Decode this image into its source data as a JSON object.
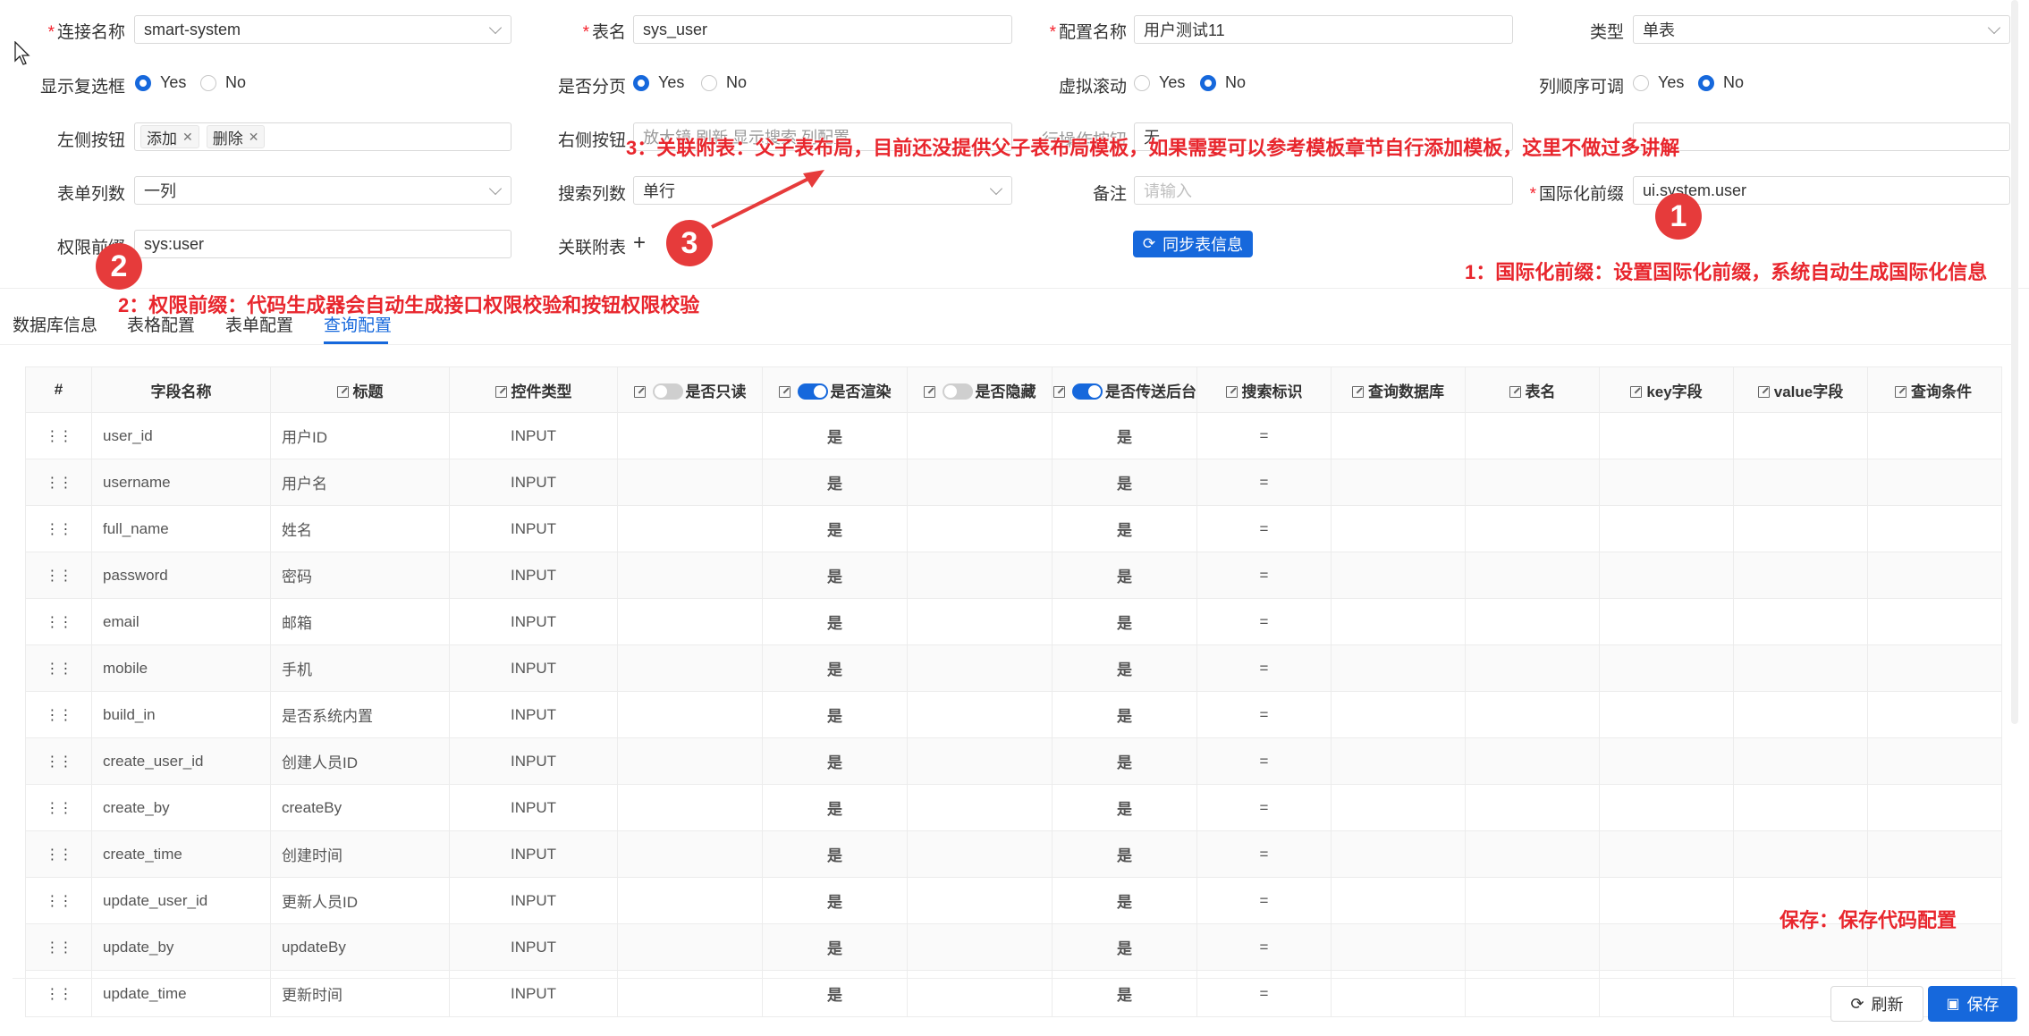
{
  "form": {
    "conn": {
      "label": "连接名称",
      "value": "smart-system"
    },
    "table": {
      "label": "表名",
      "value": "sys_user"
    },
    "config": {
      "label": "配置名称",
      "value": "用户测试11"
    },
    "type": {
      "label": "类型",
      "value": "单表"
    },
    "show_checkbox": {
      "label": "显示复选框",
      "yes": "Yes",
      "no": "No",
      "selected": "Yes"
    },
    "paging": {
      "label": "是否分页",
      "yes": "Yes",
      "no": "No",
      "selected": "Yes"
    },
    "virtual_scroll": {
      "label": "虚拟滚动",
      "yes": "Yes",
      "no": "No",
      "selected": "No"
    },
    "col_order": {
      "label": "列顺序可调",
      "yes": "Yes",
      "no": "No",
      "selected": "No"
    },
    "left_buttons": {
      "label": "左侧按钮",
      "tags": [
        "添加",
        "删除"
      ]
    },
    "right_buttons": {
      "label": "右侧按钮",
      "partial": "放大镜   刷新   显示搜索   列配置"
    },
    "form_cols": {
      "label": "表单列数",
      "value": "一列"
    },
    "search_cols": {
      "label": "搜索列数",
      "value": "单行"
    },
    "remark": {
      "label": "备注",
      "placeholder": "请输入"
    },
    "i18n": {
      "label": "国际化前缀",
      "value": "ui.system.user"
    },
    "perm": {
      "label": "权限前缀",
      "value": "sys:user"
    },
    "related": {
      "label": "关联附表",
      "add": "+"
    },
    "sync_button": "同步表信息",
    "hidden_label_1": "行操作按钮",
    "hidden_value_1": "无"
  },
  "tabs": [
    "数据库信息",
    "表格配置",
    "表单配置",
    "查询配置"
  ],
  "active_tab": "查询配置",
  "table": {
    "headers": [
      "#",
      "字段名称",
      "标题",
      "控件类型",
      "是否只读",
      "是否渲染",
      "是否隐藏",
      "是否传送后台",
      "搜索标识",
      "查询数据库",
      "表名",
      "key字段",
      "value字段",
      "查询条件"
    ],
    "rows": [
      {
        "field": "user_id",
        "title": "用户ID",
        "ctrl": "INPUT",
        "render": "是",
        "send": "是",
        "search": "="
      },
      {
        "field": "username",
        "title": "用户名",
        "ctrl": "INPUT",
        "render": "是",
        "send": "是",
        "search": "="
      },
      {
        "field": "full_name",
        "title": "姓名",
        "ctrl": "INPUT",
        "render": "是",
        "send": "是",
        "search": "="
      },
      {
        "field": "password",
        "title": "密码",
        "ctrl": "INPUT",
        "render": "是",
        "send": "是",
        "search": "="
      },
      {
        "field": "email",
        "title": "邮箱",
        "ctrl": "INPUT",
        "render": "是",
        "send": "是",
        "search": "="
      },
      {
        "field": "mobile",
        "title": "手机",
        "ctrl": "INPUT",
        "render": "是",
        "send": "是",
        "search": "="
      },
      {
        "field": "build_in",
        "title": "是否系统内置",
        "ctrl": "INPUT",
        "render": "是",
        "send": "是",
        "search": "="
      },
      {
        "field": "create_user_id",
        "title": "创建人员ID",
        "ctrl": "INPUT",
        "render": "是",
        "send": "是",
        "search": "="
      },
      {
        "field": "create_by",
        "title": "createBy",
        "ctrl": "INPUT",
        "render": "是",
        "send": "是",
        "search": "="
      },
      {
        "field": "create_time",
        "title": "创建时间",
        "ctrl": "INPUT",
        "render": "是",
        "send": "是",
        "search": "="
      },
      {
        "field": "update_user_id",
        "title": "更新人员ID",
        "ctrl": "INPUT",
        "render": "是",
        "send": "是",
        "search": "="
      },
      {
        "field": "update_by",
        "title": "updateBy",
        "ctrl": "INPUT",
        "render": "是",
        "send": "是",
        "search": "="
      },
      {
        "field": "update_time",
        "title": "更新时间",
        "ctrl": "INPUT",
        "render": "是",
        "send": "是",
        "search": "="
      }
    ]
  },
  "footer": {
    "refresh": "刷新",
    "save": "保存"
  },
  "annotations": {
    "note1": "1：国际化前缀：设置国际化前缀，系统自动生成国际化信息",
    "note2": "2：权限前缀：代码生成器会自动生成接口权限校验和按钮权限校验",
    "note3": "3：关联附表：父子表布局，目前还没提供父子表布局模板，如果需要可以参考模板章节自行添加模板，这里不做过多讲解",
    "note_save": "保存：保存代码配置",
    "badge1": "1",
    "badge2": "2",
    "badge3": "3"
  },
  "colors": {
    "primary": "#1668dc",
    "annotation": "#e8262d",
    "yes": "#1a8f1a"
  }
}
